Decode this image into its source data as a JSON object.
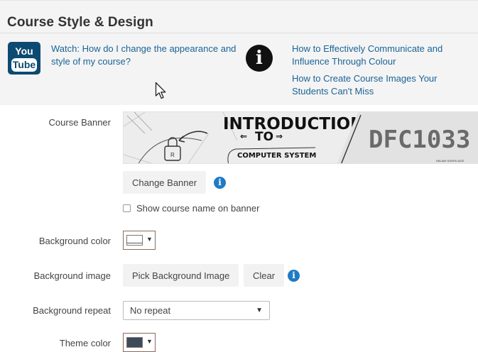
{
  "panel": {
    "title": "Course Style & Design",
    "youtube_icon": {
      "icon": "youtube-icon",
      "top": "You",
      "bottom": "Tube",
      "color": "#0d4a72"
    },
    "watch_link": "Watch: How do I change the appearance and style of my course?",
    "info_icon": "info-circle-icon",
    "links": [
      "How to Effectively Communicate and Influence Through Colour",
      "How to Create Course Images Your Students Can't Miss"
    ]
  },
  "form": {
    "course_banner": {
      "label": "Course Banner",
      "image_text": {
        "line1": "INTRODUCTION",
        "line2": "TO",
        "line3": "COMPUTER SYSTEM",
        "code": "DFC1033",
        "small": "HALIAH SOKRU AZIZ"
      },
      "change_button": "Change Banner",
      "show_name_label": "Show course name on banner",
      "show_name_checked": false
    },
    "background_color": {
      "label": "Background color",
      "value": "#ffffff"
    },
    "background_image": {
      "label": "Background image",
      "pick_button": "Pick Background Image",
      "clear_button": "Clear"
    },
    "background_repeat": {
      "label": "Background repeat",
      "selected": "No repeat"
    },
    "theme_color": {
      "label": "Theme color",
      "value": "#3d4a5a"
    }
  },
  "colors": {
    "link": "#1a6496",
    "info_badge": "#1f7ac4",
    "panel_bg": "#f4f4f4"
  }
}
